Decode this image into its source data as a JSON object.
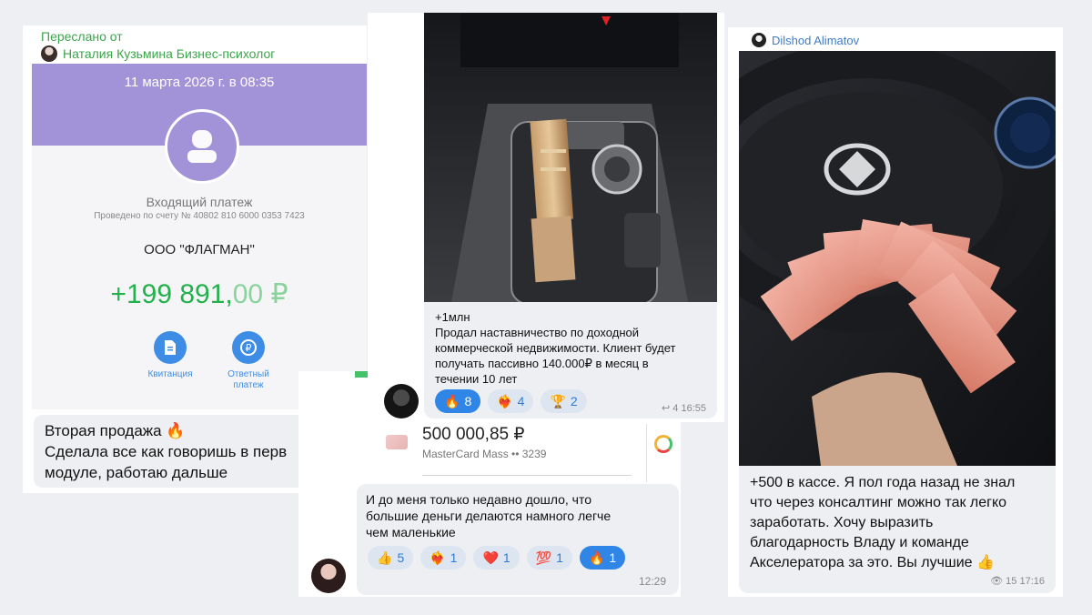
{
  "card1": {
    "forwarded_label": "Переслано от",
    "forwarded_author": "Наталия Кузьмина Бизнес-психолог",
    "bank": {
      "date": "11 марта 2026 г. в 08:35",
      "type": "Входящий платеж",
      "account": "Проведено по счету № 40802 810 6000 0353 7423",
      "payer": "ООО \"ФЛАГМАН\"",
      "amount_main": "+199 891,",
      "amount_decimals": "00 ₽",
      "receipt_label": "Квитанция",
      "reply_label": "Ответный\nплатеж",
      "accent_color": "#a293d8",
      "amount_color": "#23b14d"
    },
    "message": "Вторая продажа 🔥\nСделала все как говоришь в перв\nмодуле, работаю дальше"
  },
  "card2": {
    "message": "+1млн\nПродал наставничество по доходной\nкоммерческой недвижимости. Клиент будет\nполучать пассивно 140.000₽ в месяц в\nтечении 10 лет",
    "reactions": [
      {
        "emoji": "🔥",
        "count": "8"
      },
      {
        "emoji": "❤️‍🔥",
        "count": "4"
      },
      {
        "emoji": "🏆",
        "count": "2"
      }
    ],
    "meta": "↩ 4 16:55"
  },
  "card3": {
    "payment_amount": "500 000,85 ₽",
    "payment_card": "MasterCard Mass •• 3239",
    "message": "И до меня только недавно дошло, что\nбольшие деньги делаются намного легче\nчем маленькие",
    "reactions": [
      {
        "emoji": "👍",
        "count": "5"
      },
      {
        "emoji": "❤️‍🔥",
        "count": "1"
      },
      {
        "emoji": "❤️",
        "count": "1"
      },
      {
        "emoji": "💯",
        "count": "1"
      },
      {
        "emoji": "🔥",
        "count": "1",
        "active": true
      }
    ],
    "time": "12:29"
  },
  "card4": {
    "author": "Dilshod Alimatov",
    "message": "+500 в кассе. Я пол года назад не знал\nчто через консалтинг можно так легко\nзаработать. Хочу выразить\nблагодарность Владу и команде\nАкселератора за это. Вы лучшие 👍",
    "meta": "👁 15 17:16"
  }
}
